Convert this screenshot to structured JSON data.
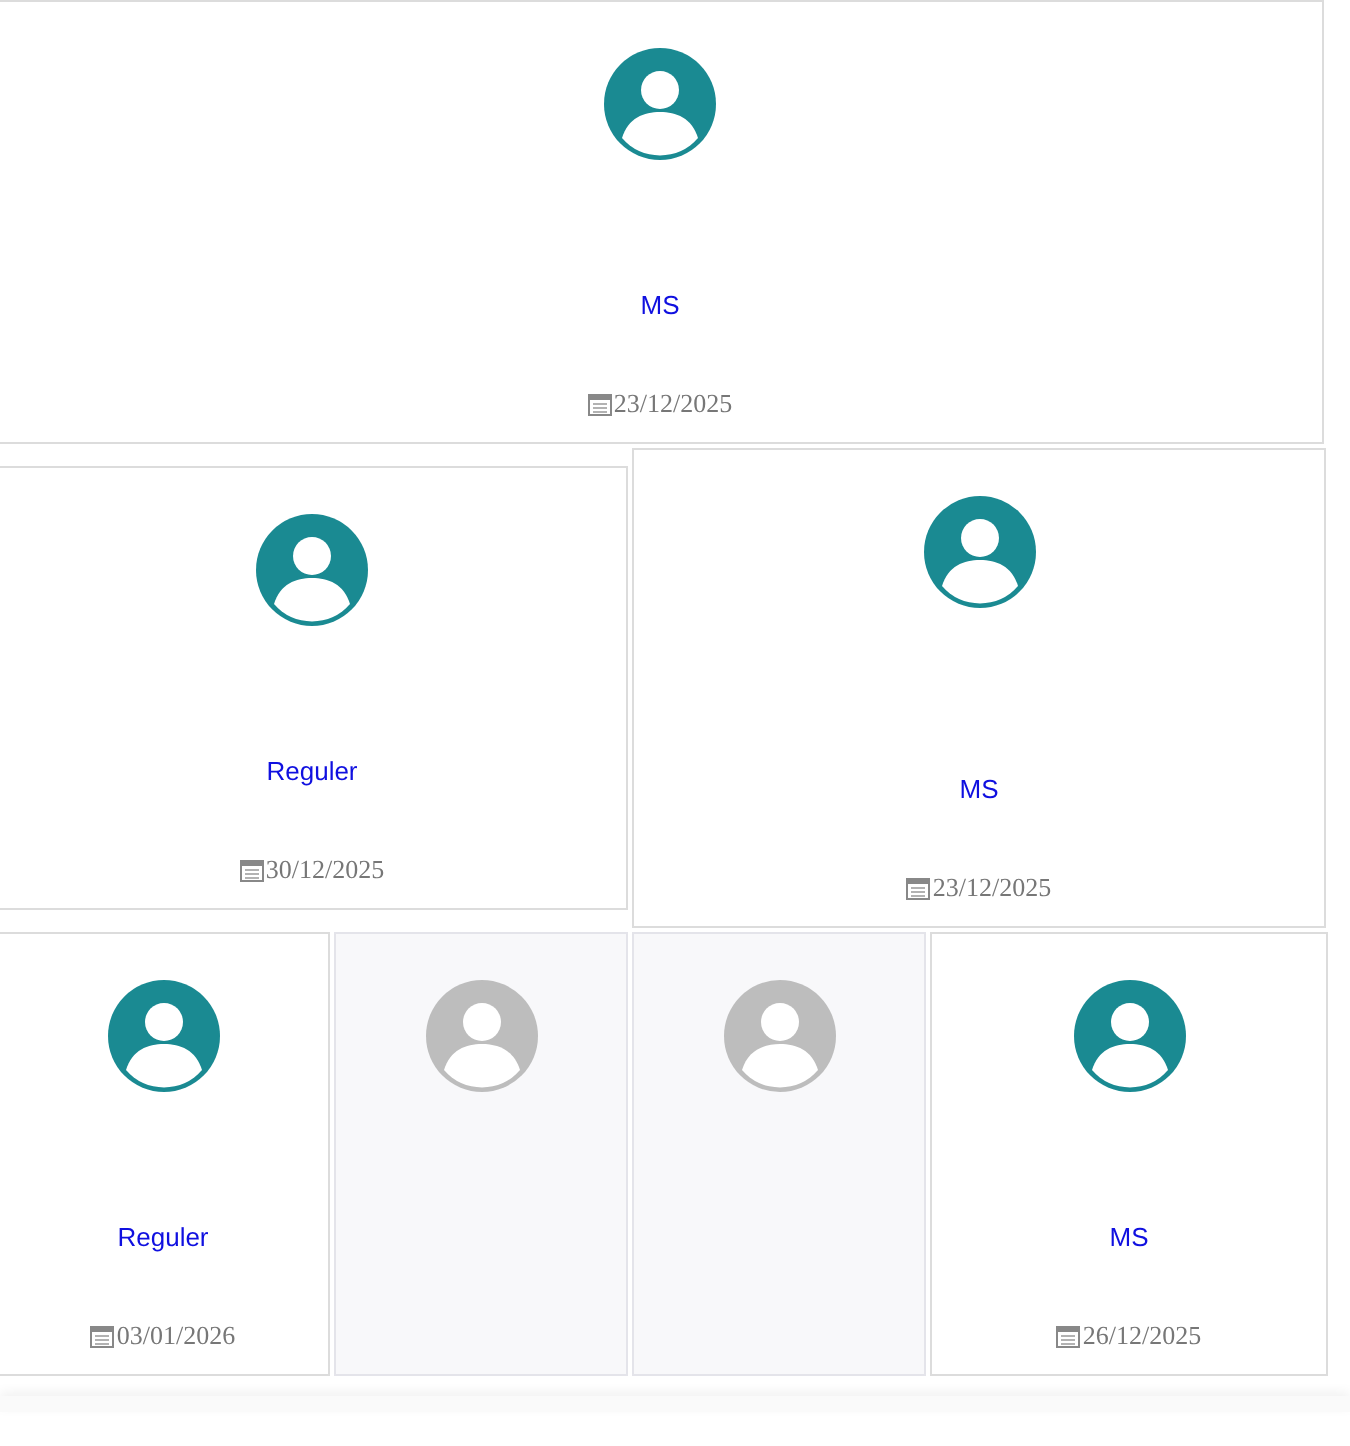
{
  "rows": [
    [
      {
        "kind": "person",
        "category": "MS",
        "date": "23/12/2025"
      }
    ],
    [
      {
        "kind": "person",
        "category": "Reguler",
        "date": "30/12/2025"
      },
      {
        "kind": "person",
        "category": "MS",
        "date": "23/12/2025"
      }
    ],
    [
      {
        "kind": "person",
        "category": "Reguler",
        "date": "03/01/2026"
      },
      {
        "kind": "placeholder"
      },
      {
        "kind": "placeholder"
      },
      {
        "kind": "person",
        "category": "MS",
        "date": "26/12/2025"
      }
    ]
  ]
}
